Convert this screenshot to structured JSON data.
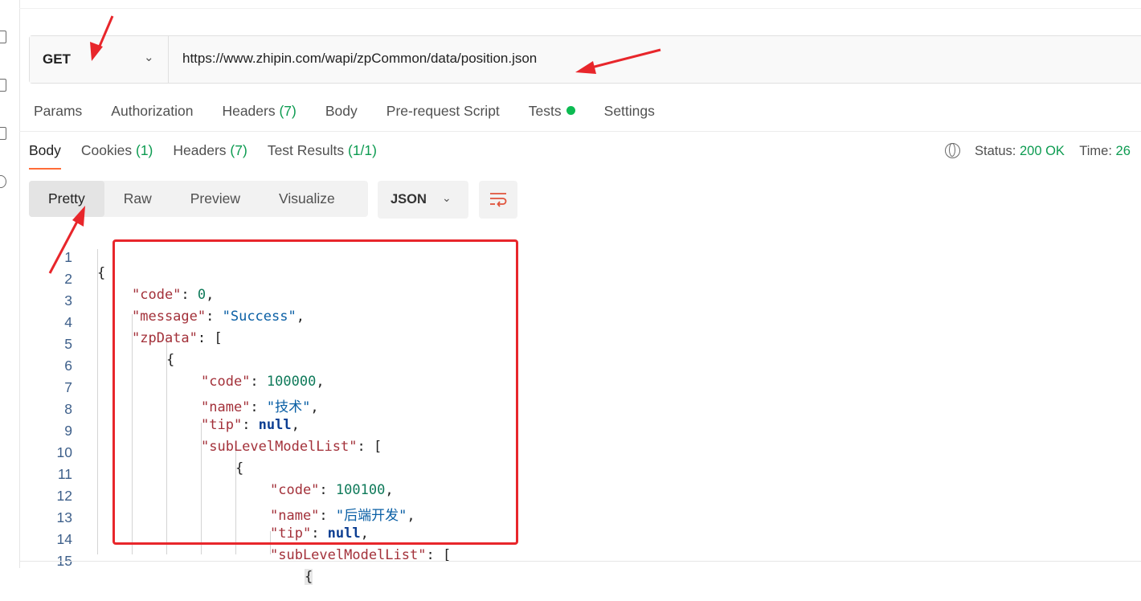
{
  "request": {
    "method": "GET",
    "url": "https://www.zhipin.com/wapi/zpCommon/data/position.json"
  },
  "request_tabs": [
    {
      "label": "Params",
      "count": ""
    },
    {
      "label": "Authorization",
      "count": ""
    },
    {
      "label": "Headers",
      "count": "(7)"
    },
    {
      "label": "Body",
      "count": ""
    },
    {
      "label": "Pre-request Script",
      "count": ""
    },
    {
      "label": "Tests",
      "count": ""
    },
    {
      "label": "Settings",
      "count": ""
    }
  ],
  "response_tabs": [
    {
      "label": "Body",
      "count": ""
    },
    {
      "label": "Cookies",
      "count": "(1)"
    },
    {
      "label": "Headers",
      "count": "(7)"
    },
    {
      "label": "Test Results",
      "count": "(1/1)"
    }
  ],
  "status": {
    "status_label": "Status:",
    "status_value": "200 OK",
    "time_label": "Time:",
    "time_value": "26"
  },
  "view_modes": [
    "Pretty",
    "Raw",
    "Preview",
    "Visualize"
  ],
  "format": "JSON",
  "code_lines": [
    {
      "n": "1"
    },
    {
      "n": "2"
    },
    {
      "n": "3"
    },
    {
      "n": "4"
    },
    {
      "n": "5"
    },
    {
      "n": "6"
    },
    {
      "n": "7"
    },
    {
      "n": "8"
    },
    {
      "n": "9"
    },
    {
      "n": "10"
    },
    {
      "n": "11"
    },
    {
      "n": "12"
    },
    {
      "n": "13"
    },
    {
      "n": "14"
    },
    {
      "n": "15"
    }
  ],
  "json": {
    "brace_open": "{",
    "bracket_open": "[",
    "k_code": "\"code\"",
    "v_code_root": "0",
    "k_message": "\"message\"",
    "v_message": "\"Success\"",
    "k_zpData": "\"zpData\"",
    "k_name": "\"name\"",
    "k_tip": "\"tip\"",
    "k_sub": "\"subLevelModelList\"",
    "v_code_1": "100000",
    "v_name_1": "\"技术\"",
    "v_null": "null",
    "v_code_2": "100100",
    "v_name_2": "\"后端开发\""
  },
  "colors": {
    "accent": "#ff6c37",
    "success": "#0d9b51",
    "annotation": "#e8262b"
  }
}
